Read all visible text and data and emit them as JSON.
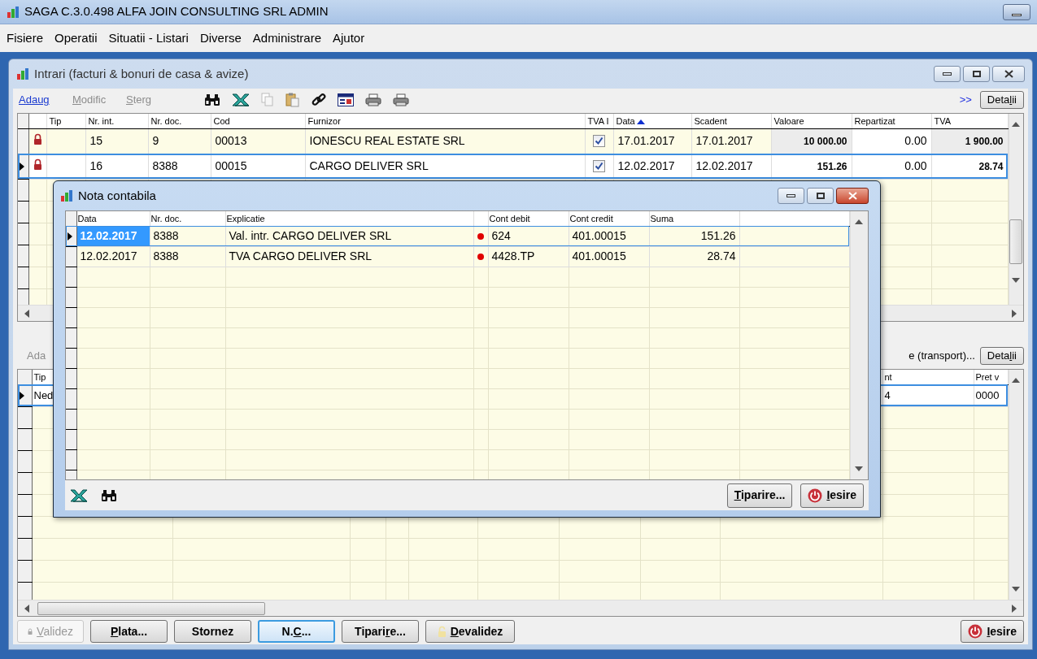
{
  "window": {
    "title": "SAGA C.3.0.498  ALFA JOIN CONSULTING SRL  ADMIN"
  },
  "menu": [
    "Fisiere",
    "Operatii",
    "Situatii - Listari",
    "Diverse",
    "Administrare",
    "Ajutor"
  ],
  "document_window": {
    "title": "Intrari (facturi & bonuri de casa & avize)",
    "actions": [
      {
        "key": "A",
        "post": "daug",
        "disabled": false
      },
      {
        "key": "M",
        "post": "odific",
        "disabled": true
      },
      {
        "key": "S",
        "post": "terg",
        "disabled": true
      }
    ],
    "more": ">>",
    "details_button": {
      "pre": "Deta",
      "key": "l",
      "post": "ii"
    },
    "grid": {
      "columns": [
        {
          "label": "Tip"
        },
        {
          "label": "Nr. int."
        },
        {
          "label": "Nr. doc."
        },
        {
          "label": "Cod"
        },
        {
          "label": "Furnizor"
        },
        {
          "label": "TVA I"
        },
        {
          "label": "Data",
          "sorted": true
        },
        {
          "label": "Scadent"
        },
        {
          "label": "Valoare"
        },
        {
          "label": "Repartizat"
        },
        {
          "label": "TVA"
        }
      ],
      "rows": [
        {
          "selected": false,
          "locked": true,
          "nr_int": "15",
          "nr_doc": "9",
          "cod": "00013",
          "furnizor": "IONESCU REAL ESTATE SRL",
          "tva_i": true,
          "data": "17.01.2017",
          "scadent": "17.01.2017",
          "valoare": "10 000.00",
          "repartizat": "0.00",
          "tva": "1 900.00"
        },
        {
          "selected": true,
          "locked": true,
          "nr_int": "16",
          "nr_doc": "8388",
          "cod": "00015",
          "furnizor": "CARGO DELIVER SRL",
          "tva_i": true,
          "data": "12.02.2017",
          "scadent": "12.02.2017",
          "valoare": "151.26",
          "repartizat": "0.00",
          "tva": "28.74"
        }
      ]
    },
    "lower_toolbar": {
      "left_text": "Ada",
      "right_text": "e (transport)...",
      "details_button": {
        "pre": "Deta",
        "key": "l",
        "post": "ii"
      }
    },
    "lower_grid": {
      "columns": [
        {
          "label": "Tip"
        },
        {
          "label": "nt"
        },
        {
          "label": "Pret v"
        }
      ],
      "rows": [
        {
          "selected": true,
          "cells": [
            "Ned",
            "4",
            "0000"
          ]
        }
      ]
    },
    "buttons": [
      {
        "kind": "locked",
        "key": "V",
        "post": "alidez",
        "disabled": true,
        "focused": false
      },
      {
        "kind": "plain",
        "key": "P",
        "post": "lata...",
        "disabled": false,
        "focused": false
      },
      {
        "kind": "plain",
        "post": "Stornez",
        "disabled": false,
        "focused": false
      },
      {
        "kind": "plain",
        "pre": "N.",
        "key": "C",
        "post": "...",
        "disabled": false,
        "focused": true
      },
      {
        "kind": "plain",
        "pre": "Tipari",
        "key": "r",
        "post": "e...",
        "disabled": false,
        "focused": false
      },
      {
        "kind": "unlocked",
        "key": "D",
        "post": "evalidez",
        "disabled": false,
        "focused": false
      }
    ],
    "exit_button": {
      "key": "I",
      "post": "esire"
    }
  },
  "dialog": {
    "title": "Nota contabila",
    "grid": {
      "columns": [
        {
          "label": "Data"
        },
        {
          "label": "Nr. doc."
        },
        {
          "label": "Explicatie"
        },
        {
          "label": "Cont debit"
        },
        {
          "label": "Cont credit"
        },
        {
          "label": "Suma"
        }
      ],
      "rows": [
        {
          "selected": true,
          "data": "12.02.2017",
          "nr_doc": "8388",
          "explicatie": "Val. intr. CARGO DELIVER SRL",
          "flag": true,
          "cont_debit": "624",
          "cont_credit": "401.00015",
          "suma": "151.26"
        },
        {
          "selected": false,
          "data": "12.02.2017",
          "nr_doc": "8388",
          "explicatie": "TVA CARGO DELIVER SRL",
          "flag": true,
          "cont_debit": "4428.TP",
          "cont_credit": "401.00015",
          "suma": "28.74"
        }
      ]
    },
    "buttons": [
      {
        "kind": "plain",
        "key": "T",
        "post": "iparire..."
      },
      {
        "kind": "exit",
        "key": "I",
        "post": "esire"
      }
    ]
  }
}
